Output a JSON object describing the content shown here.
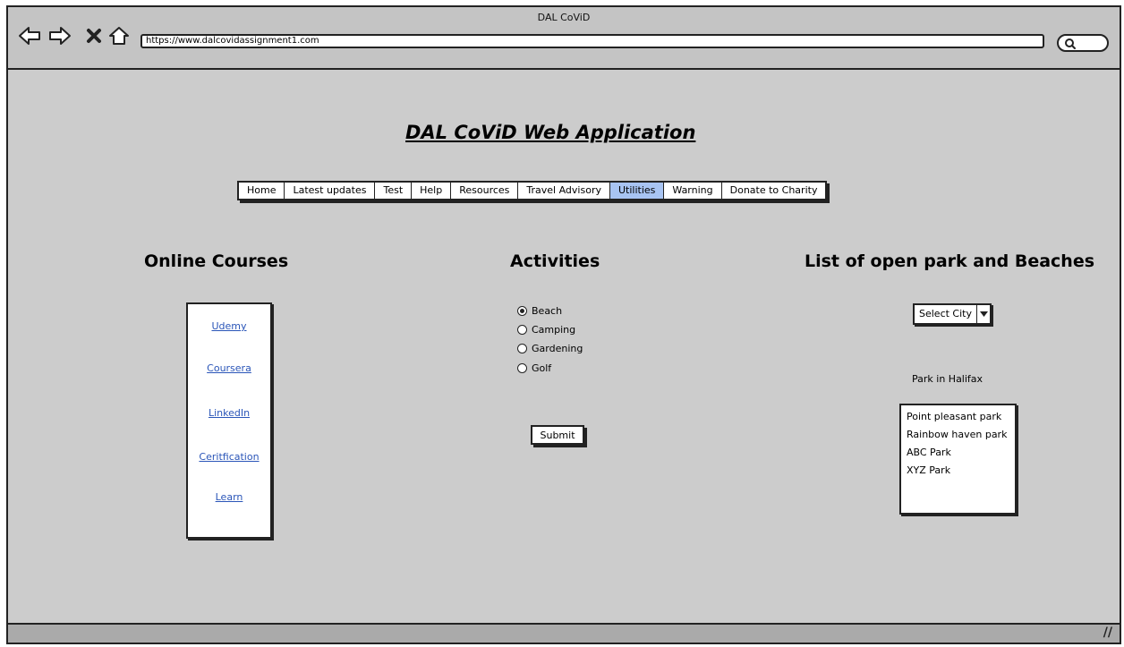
{
  "window": {
    "title": "DAL CoViD",
    "url": "https://www.dalcovidassignment1.com"
  },
  "icons": {
    "back": "back-arrow-icon",
    "forward": "forward-arrow-icon",
    "stop": "close-icon",
    "home": "home-icon",
    "search": "search-icon",
    "resize": "resize-grip-icon"
  },
  "header": {
    "title": "DAL CoViD Web Application"
  },
  "menu": {
    "items": [
      {
        "label": "Home"
      },
      {
        "label": "Latest updates"
      },
      {
        "label": "Test"
      },
      {
        "label": "Help"
      },
      {
        "label": "Resources"
      },
      {
        "label": "Travel Advisory"
      },
      {
        "label": "Utilities",
        "active": true
      },
      {
        "label": "Warning"
      },
      {
        "label": "Donate to Charity"
      }
    ]
  },
  "online_courses": {
    "title": "Online Courses",
    "links": [
      "Udemy",
      "Coursera",
      "LinkedIn",
      "Ceritfication",
      "Learn"
    ]
  },
  "activities": {
    "title": "Activities",
    "options": [
      "Beach",
      "Camping",
      "Gardening",
      "Golf"
    ],
    "selected": "Beach",
    "submit_label": "Submit"
  },
  "parks": {
    "title": "List of open park and Beaches",
    "select_label": "Select City",
    "list_label": "Park in Halifax",
    "items": [
      "Point pleasant park",
      "Rainbow haven park",
      "ABC Park",
      "XYZ Park"
    ]
  },
  "colors": {
    "active_tab": "#a8c4f2",
    "link": "#2a55b8",
    "background": "#cccccc"
  }
}
